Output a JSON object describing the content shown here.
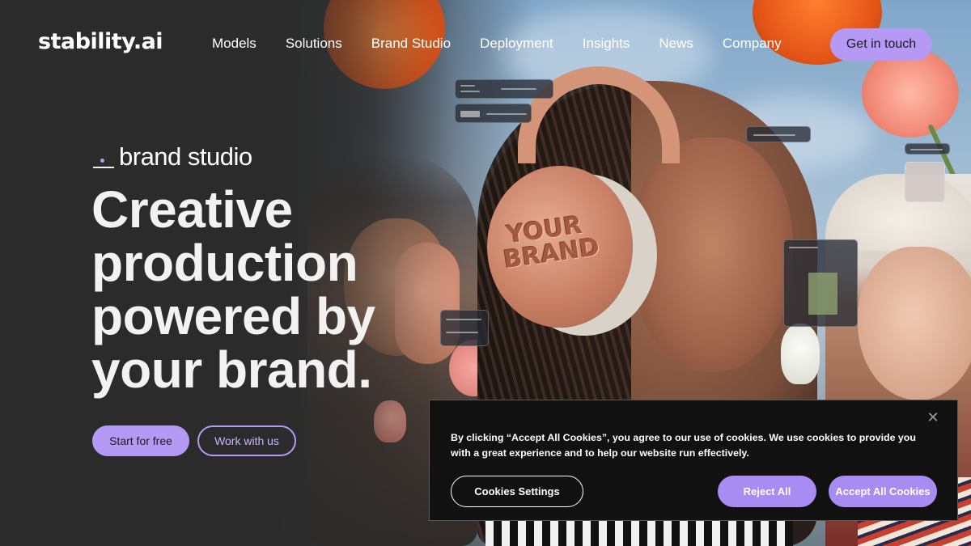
{
  "header": {
    "logo": "stability.ai",
    "nav": [
      "Models",
      "Solutions",
      "Brand Studio",
      "Deployment",
      "Insights",
      "News",
      "Company"
    ],
    "cta": "Get in touch"
  },
  "hero": {
    "tag": "brand studio",
    "headline": [
      "Creative",
      "production",
      "powered by",
      "your brand."
    ],
    "primary_button": "Start for free",
    "secondary_button": "Work with us",
    "image_brand_text": [
      "YOUR",
      "BRAND"
    ]
  },
  "cookie_banner": {
    "message": "By clicking “Accept All Cookies”, you agree to our use of cookies. We use cookies to provide you with a great experience and to help our website run effectively.",
    "settings_button": "Cookies Settings",
    "reject_button": "Reject All",
    "accept_button": "Accept All Cookies",
    "close_icon": "close-icon"
  },
  "colors": {
    "accent": "#b49af5",
    "background": "#2b2b2b",
    "cookie_bg": "#111111"
  }
}
